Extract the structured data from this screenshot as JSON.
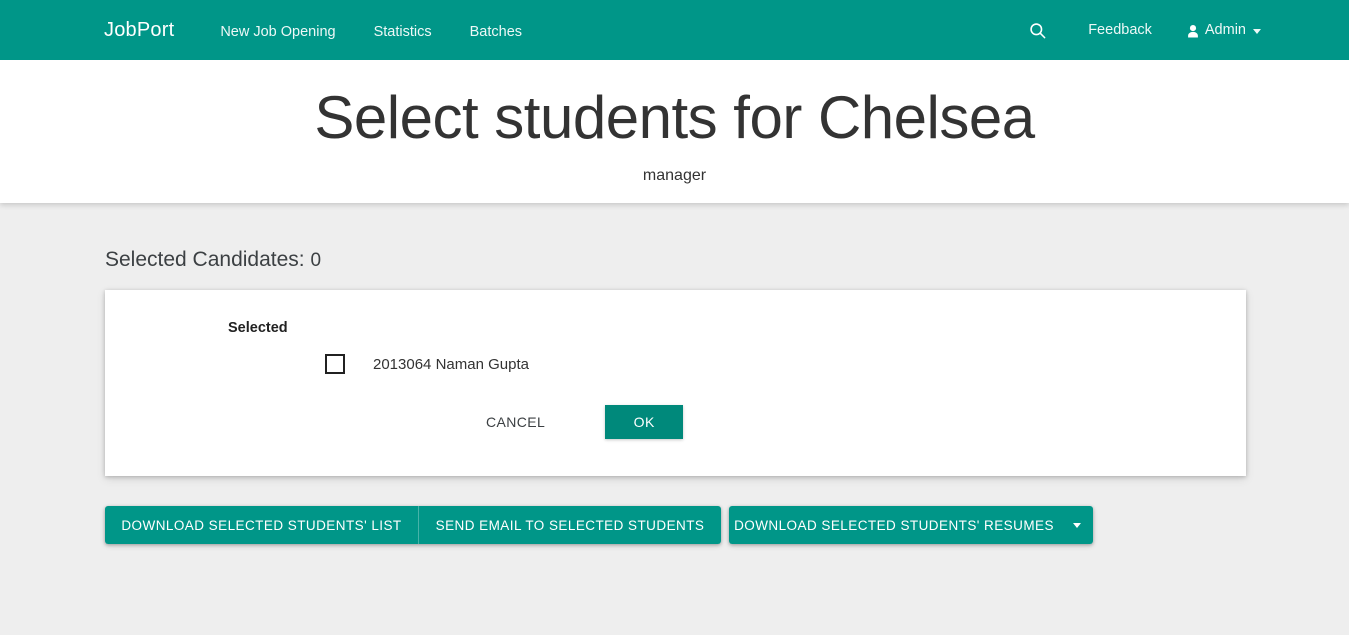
{
  "navbar": {
    "brand": "JobPort",
    "links": [
      {
        "label": "New Job Opening"
      },
      {
        "label": "Statistics"
      },
      {
        "label": "Batches"
      }
    ],
    "search_icon": "search-icon",
    "feedback_label": "Feedback",
    "user_label": "Admin",
    "user_icon": "user-icon",
    "caret_icon": "chevron-down-icon",
    "background_color": "#009688"
  },
  "header": {
    "title": "Select students for Chelsea",
    "subtitle": "manager"
  },
  "main": {
    "selected_candidates_label": "Selected Candidates:",
    "selected_candidates_count": "0"
  },
  "card": {
    "group_label": "Selected",
    "candidates": [
      {
        "id": "2013064",
        "name": "Naman Gupta",
        "display": "2013064 Naman Gupta",
        "checked": false
      }
    ],
    "cancel_label": "CANCEL",
    "ok_label": "OK"
  },
  "button_bar": {
    "download_list_label": "DOWNLOAD SELECTED STUDENTS' LIST",
    "send_email_label": "SEND EMAIL TO SELECTED STUDENTS",
    "download_resumes_label": "DOWNLOAD SELECTED STUDENTS' RESUMES",
    "dropdown_icon": "caret-down-icon"
  },
  "colors": {
    "accent": "#009688",
    "accent_dark": "#00897b",
    "page_background": "#eeeeee",
    "card_background": "#ffffff",
    "text": "#333333"
  }
}
